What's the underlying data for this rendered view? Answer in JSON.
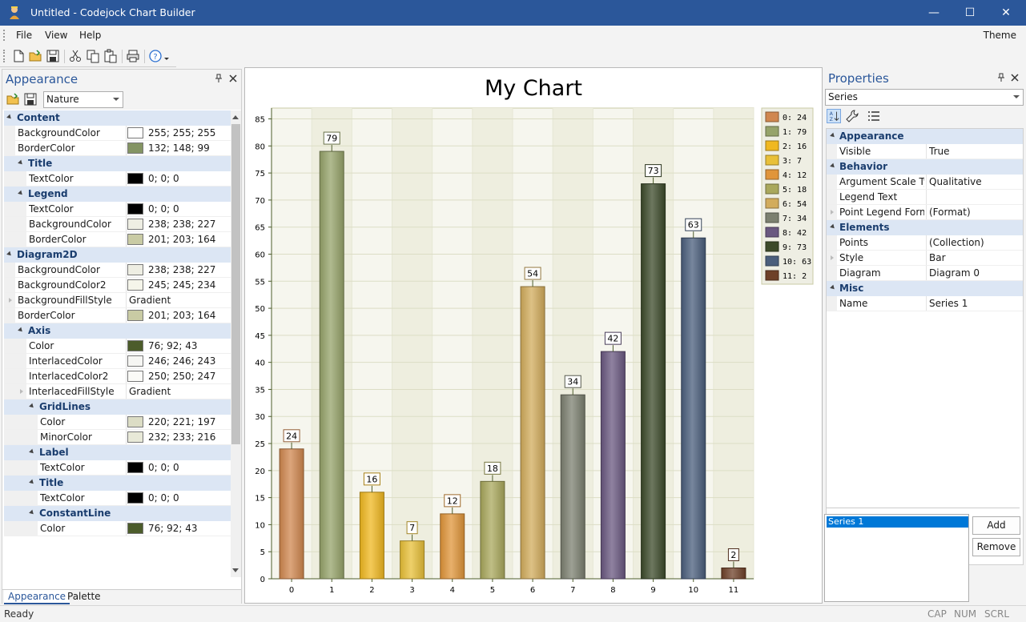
{
  "window": {
    "title": "Untitled - Codejock Chart Builder",
    "minimize_glyph": "—",
    "maximize_glyph": "☐",
    "close_glyph": "✕"
  },
  "menu": {
    "items": [
      "File",
      "View",
      "Help"
    ],
    "theme": "Theme"
  },
  "toolbar": {
    "icons": [
      "new-file-icon",
      "open-folder-icon",
      "save-icon",
      "cut-icon",
      "copy-icon",
      "paste-icon",
      "print-icon",
      "help-icon"
    ]
  },
  "appearance_panel": {
    "title": "Appearance",
    "theme_combo": "Nature",
    "rows": [
      {
        "type": "cat",
        "level": 0,
        "name": "Content"
      },
      {
        "type": "prop",
        "level": 0,
        "name": "BackgroundColor",
        "value": "255; 255; 255",
        "swatch": "#ffffff"
      },
      {
        "type": "prop",
        "level": 0,
        "name": "BorderColor",
        "value": "132; 148; 99",
        "swatch": "#849463"
      },
      {
        "type": "cat",
        "level": 1,
        "name": "Title"
      },
      {
        "type": "prop",
        "level": 1,
        "name": "TextColor",
        "value": "0; 0; 0",
        "swatch": "#000000"
      },
      {
        "type": "cat",
        "level": 1,
        "name": "Legend"
      },
      {
        "type": "prop",
        "level": 1,
        "name": "TextColor",
        "value": "0; 0; 0",
        "swatch": "#000000"
      },
      {
        "type": "prop",
        "level": 1,
        "name": "BackgroundColor",
        "value": "238; 238; 227",
        "swatch": "#eeeee3"
      },
      {
        "type": "prop",
        "level": 1,
        "name": "BorderColor",
        "value": "201; 203; 164",
        "swatch": "#c9cba4"
      },
      {
        "type": "cat",
        "level": 0,
        "name": "Diagram2D"
      },
      {
        "type": "prop",
        "level": 0,
        "name": "BackgroundColor",
        "value": "238; 238; 227",
        "swatch": "#eeeee3"
      },
      {
        "type": "prop",
        "level": 0,
        "name": "BackgroundColor2",
        "value": "245; 245; 234",
        "swatch": "#f5f5ea"
      },
      {
        "type": "prop",
        "level": 0,
        "name": "BackgroundFillStyle",
        "value": "Gradient",
        "expandable": true
      },
      {
        "type": "prop",
        "level": 0,
        "name": "BorderColor",
        "value": "201; 203; 164",
        "swatch": "#c9cba4"
      },
      {
        "type": "cat",
        "level": 1,
        "name": "Axis"
      },
      {
        "type": "prop",
        "level": 1,
        "name": "Color",
        "value": "76; 92; 43",
        "swatch": "#4c5c2b"
      },
      {
        "type": "prop",
        "level": 1,
        "name": "InterlacedColor",
        "value": "246; 246; 243",
        "swatch": "#f6f6f3"
      },
      {
        "type": "prop",
        "level": 1,
        "name": "InterlacedColor2",
        "value": "250; 250; 247",
        "swatch": "#fafaf7"
      },
      {
        "type": "prop",
        "level": 1,
        "name": "InterlacedFillStyle",
        "value": "Gradient",
        "expandable": true
      },
      {
        "type": "cat",
        "level": 2,
        "name": "GridLines"
      },
      {
        "type": "prop",
        "level": 2,
        "name": "Color",
        "value": "220; 221; 197",
        "swatch": "#dcddc5"
      },
      {
        "type": "prop",
        "level": 2,
        "name": "MinorColor",
        "value": "232; 233; 216",
        "swatch": "#e8e9d8"
      },
      {
        "type": "cat",
        "level": 2,
        "name": "Label"
      },
      {
        "type": "prop",
        "level": 2,
        "name": "TextColor",
        "value": "0; 0; 0",
        "swatch": "#000000"
      },
      {
        "type": "cat",
        "level": 2,
        "name": "Title"
      },
      {
        "type": "prop",
        "level": 2,
        "name": "TextColor",
        "value": "0; 0; 0",
        "swatch": "#000000"
      },
      {
        "type": "cat",
        "level": 2,
        "name": "ConstantLine"
      },
      {
        "type": "prop",
        "level": 2,
        "name": "Color",
        "value": "76; 92; 43",
        "swatch": "#4c5c2b"
      }
    ],
    "tabs": [
      "Appearance",
      "Palette"
    ]
  },
  "properties_panel": {
    "title": "Properties",
    "object_combo": "Series",
    "rows": [
      {
        "type": "cat",
        "name": "Appearance"
      },
      {
        "type": "prop",
        "name": "Visible",
        "value": "True"
      },
      {
        "type": "cat",
        "name": "Behavior"
      },
      {
        "type": "prop",
        "name": "Argument Scale Type",
        "value": "Qualitative"
      },
      {
        "type": "prop",
        "name": "Legend Text",
        "value": ""
      },
      {
        "type": "prop",
        "name": "Point Legend Format",
        "value": "(Format)",
        "expandable": true
      },
      {
        "type": "cat",
        "name": "Elements"
      },
      {
        "type": "prop",
        "name": "Points",
        "value": "(Collection)"
      },
      {
        "type": "prop",
        "name": "Style",
        "value": "Bar",
        "expandable": true
      },
      {
        "type": "prop",
        "name": "Diagram",
        "value": "Diagram 0"
      },
      {
        "type": "cat",
        "name": "Misc"
      },
      {
        "type": "prop",
        "name": "Name",
        "value": "Series 1"
      }
    ],
    "series_list": [
      "Series 1"
    ],
    "add_label": "Add",
    "remove_label": "Remove"
  },
  "status": {
    "text": "Ready",
    "indicators": [
      "CAP",
      "NUM",
      "SCRL"
    ]
  },
  "chart_data": {
    "type": "bar",
    "title": "My Chart",
    "categories": [
      "0",
      "1",
      "2",
      "3",
      "4",
      "5",
      "6",
      "7",
      "8",
      "9",
      "10",
      "11"
    ],
    "values": [
      24,
      79,
      16,
      7,
      12,
      18,
      54,
      34,
      42,
      73,
      63,
      2
    ],
    "colors": [
      "#d0874f",
      "#96a36a",
      "#f0b820",
      "#e8c038",
      "#e0953a",
      "#a9a85c",
      "#d2ac5c",
      "#7c8070",
      "#6a5880",
      "#3c4a2a",
      "#4a5e7c",
      "#6e4028"
    ],
    "legend": [
      "0: 24",
      "1: 79",
      "2: 16",
      "3: 7",
      "4: 12",
      "5: 18",
      "6: 54",
      "7: 34",
      "8: 42",
      "9: 73",
      "10: 63",
      "11: 2"
    ],
    "legend_position": "top-right",
    "ylim": [
      0,
      87
    ],
    "yticks": [
      0,
      5,
      10,
      15,
      20,
      25,
      30,
      35,
      40,
      45,
      50,
      55,
      60,
      65,
      70,
      75,
      80,
      85
    ],
    "grid": true,
    "data_labels": true
  }
}
